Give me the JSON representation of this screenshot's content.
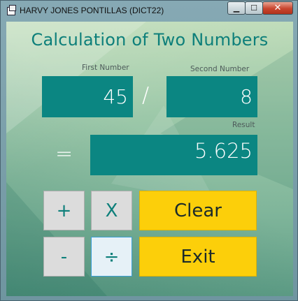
{
  "window": {
    "title": "HARVY JONES PONTILLAS (DICT22)",
    "minimize_glyph": "▁",
    "maximize_glyph": "☐",
    "close_glyph": "✕"
  },
  "main": {
    "heading": "Calculation of Two Numbers",
    "first_number": {
      "label": "First Number",
      "value": "45"
    },
    "operator_symbol": "/",
    "second_number": {
      "label": "Second Number",
      "value": "8"
    },
    "equals_symbol": "=",
    "result": {
      "label": "Result",
      "value": "5.625"
    }
  },
  "buttons": {
    "plus": "+",
    "times": "X",
    "minus": "-",
    "divide": "÷",
    "clear": "Clear",
    "exit": "Exit"
  },
  "colors": {
    "accent_teal": "#0b8682",
    "clear_exit_yellow": "#fccf0a",
    "operator_button_gray": "#dcdcdc"
  }
}
